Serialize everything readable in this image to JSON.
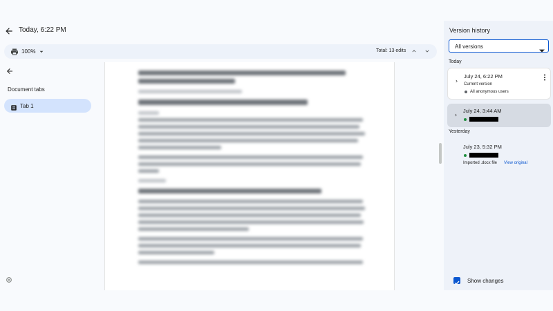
{
  "header": {
    "title": "Today, 6:22 PM"
  },
  "toolbar": {
    "zoom": "100%",
    "total_edits": "Total: 13 edits"
  },
  "left_panel": {
    "section_label": "Document tabs",
    "tabs": [
      {
        "label": "Tab 1",
        "selected": true
      }
    ]
  },
  "version_history": {
    "title": "Version history",
    "filter": {
      "selected": "All versions"
    },
    "groups": [
      {
        "label": "Today",
        "versions": [
          {
            "time": "July 24, 6:22 PM",
            "subtitle": "Current version",
            "author": "All anonymous users",
            "author_dot_color": "#5f6368"
          },
          {
            "time": "July 24, 3:44 AM",
            "author_dot_color": "#1e8e3e"
          }
        ]
      },
      {
        "label": "Yesterday",
        "versions": [
          {
            "time": "July 23, 5:32 PM",
            "author_dot_color": "#1e8e3e",
            "note": "Imported .docx file",
            "link": "View original"
          }
        ]
      }
    ],
    "show_changes": {
      "label": "Show changes",
      "checked": true
    }
  },
  "colors": {
    "accent": "#0b57d0",
    "selected_tab": "#d3e3fd",
    "panel_bg": "#eef2f9"
  }
}
